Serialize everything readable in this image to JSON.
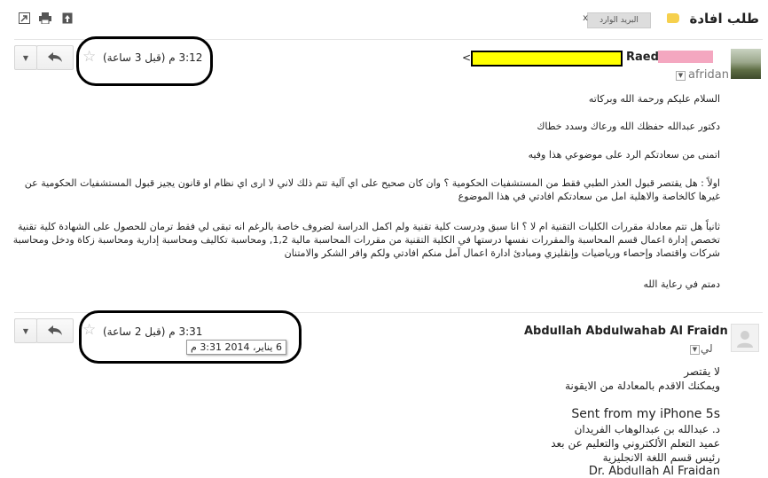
{
  "header": {
    "subject": "طلب افادة",
    "label": "البريد الوارد",
    "label_remove": "x"
  },
  "toolbar": {
    "new_window_icon": "new-window-icon",
    "print_icon": "print-icon",
    "expand_icon": "expand-icon"
  },
  "message1": {
    "sender_name": "Raed",
    "sender_email_prefix": "<",
    "to": "afridan",
    "time": "3:12 م (قبل 3 ساعة)",
    "body": [
      "السلام عليكم ورحمة الله وبركاته",
      "دكتور عبدالله حفظك الله ورعاك وسدد خطاك",
      "اتمنى من سعادتكم الرد على موضوعي هذا وفيه",
      "اولاً : هل يقتصر قبول العذر الطبي فقط من المستشفيات الحكومية ؟ وان كان صحيح على اي آلية تتم ذلك لاني لا ارى اي نظام او قانون يجيز قبول المستشفيات الحكومية عن غيرها كالخاصة والاهلية امل من سعادتكم افادتي في هذا الموضوع",
      "ثانياً هل تتم معادلة مقررات الكليات التقنية ام لا ؟  انا سبق ودرست كلية تقنية ولم اكمل الدراسة لضروف خاصة بالرغم انه تبقى لي فقط ترمان للحصول على الشهادة كلية تقنية تخصص إدارة اعمال قسم المحاسبة والمقررات نفسها درستها في الكلية التقنية من مقررات المحاسبة مالية 1,2, ومحاسبة تكاليف ومحاسبة إدارية ومحاسبة زكاة ودخل ومحاسبة شركات واقتصاد وإحصاء ورياضيات وإنقليزي ومبادئ ادارة اعمال آمل منكم افادتي ولكم وافر الشكر والامتنان",
      "دمتم في رعاية الله"
    ]
  },
  "message2": {
    "sender_name": "Abdullah Abdulwahab Al Fraidn",
    "to": "لي",
    "time": "3:31 م (قبل 2 ساعة)",
    "tooltip": "6 يناير، 2014 3:31 م",
    "body": [
      "لا يقتصر",
      "ويمكنك الاقدم بالمعادلة من الايقونة",
      "Sent from my iPhone 5s",
      "د. عبدالله بن عبدالوهاب الفريدان",
      "عميد التعلم الألكتروني والتعليم عن بعد",
      "رئيس قسم اللغة الانجليزية",
      "Dr. Abdullah Al Fraidan"
    ]
  },
  "colors": {
    "redact_yellow": "#ffff00",
    "redact_pink": "#f4a7c0",
    "label_yellow": "#f6d04d"
  }
}
